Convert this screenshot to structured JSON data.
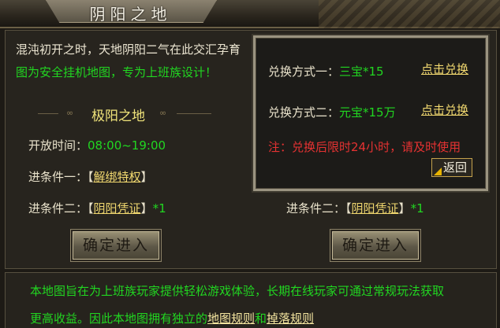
{
  "header": {
    "title": "阴阳之地"
  },
  "intro": {
    "line1": "混沌初开之时，天地阴阳二气在此交汇孕育",
    "line2": "图为安全挂机地图，专为上班族设计！"
  },
  "left_map": {
    "name": "极阳之地",
    "open_label": "开放时间：",
    "open_time": "08:00~19:00",
    "cond1_label": "进条件一：",
    "cond1_open": "【",
    "cond1_link": "解绑特权",
    "cond1_close": "】",
    "cond2_label": "进条件二：",
    "cond2_open": "【",
    "cond2_link": "阴阳凭证",
    "cond2_close": "】",
    "cond2_qty": "*1",
    "enter_label": "确定进入"
  },
  "right_map": {
    "cond2_label": "进条件二：",
    "cond2_open": "【",
    "cond2_link": "阴阳凭证",
    "cond2_close": "】",
    "cond2_qty": "*1",
    "enter_label": "确定进入"
  },
  "exchange_popup": {
    "method1_label": "兑换方式一：",
    "method1_value": "三宝*15",
    "method1_button": "点击兑换",
    "method2_label": "兑换方式二：",
    "method2_value": "元宝*15万",
    "method2_button": "点击兑换",
    "note": "注：兑换后限时24小时，请及时使用",
    "return_label": "返回"
  },
  "footer": {
    "line1": "本地图旨在为上班族玩家提供轻松游戏体验，长期在线玩家可通过常规玩法获取",
    "line2_prefix": "更高收益。因此本地图拥有独立的",
    "link1": "地图规则",
    "and": "和",
    "link2": "掉落规则"
  },
  "colors": {
    "green": "#21d621",
    "yellow": "#f1d86f",
    "red": "#e53232",
    "panel_bg": "#27241e"
  }
}
